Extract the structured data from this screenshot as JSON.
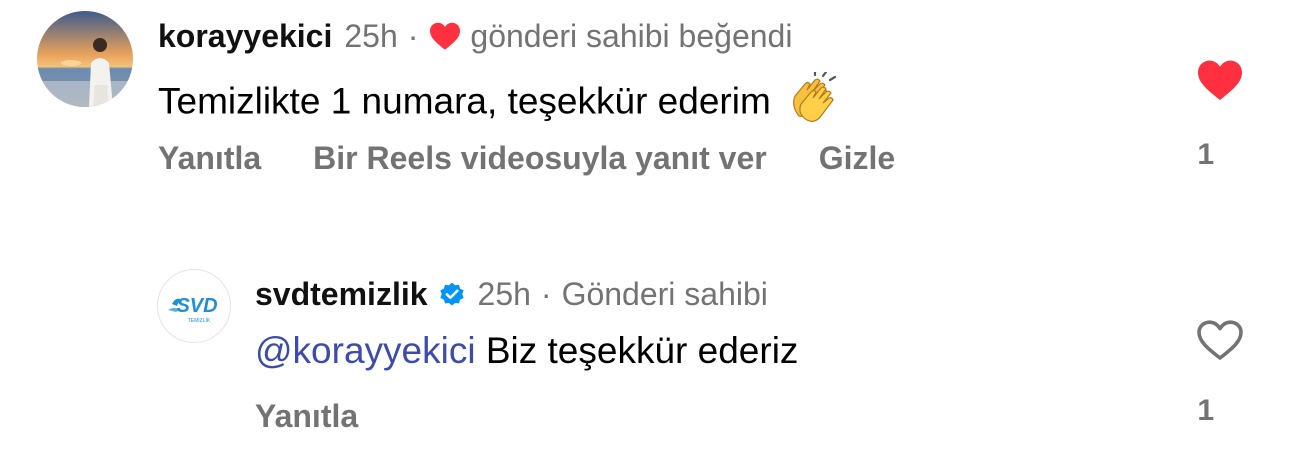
{
  "comment1": {
    "username": "korayyekici",
    "time": "25h",
    "separator": "·",
    "liked_by_author": "gönderi sahibi beğendi",
    "text": "Temizlikte 1 numara, teşekkür ederim",
    "emoji": "clapping-hands",
    "actions": {
      "reply": "Yanıtla",
      "reels_reply": "Bir Reels videosuyla yanıt ver",
      "hide": "Gizle"
    },
    "like_count": "1",
    "liked": true
  },
  "comment2": {
    "username": "svdtemizlik",
    "verified": true,
    "time": "25h",
    "separator": "·",
    "owner_label": "Gönderi sahibi",
    "avatar_logo": "SVD",
    "avatar_sub": "TEMİZLİK",
    "mention": "@korayyekici",
    "text": "Biz teşekkür ederiz",
    "actions": {
      "reply": "Yanıtla"
    },
    "like_count": "1",
    "liked": false
  },
  "colors": {
    "like_red": "#ff3040",
    "muted": "#737373",
    "mention": "#3f4ba8",
    "verified_blue": "#0095f6",
    "logo_blue": "#1f8fd6"
  }
}
